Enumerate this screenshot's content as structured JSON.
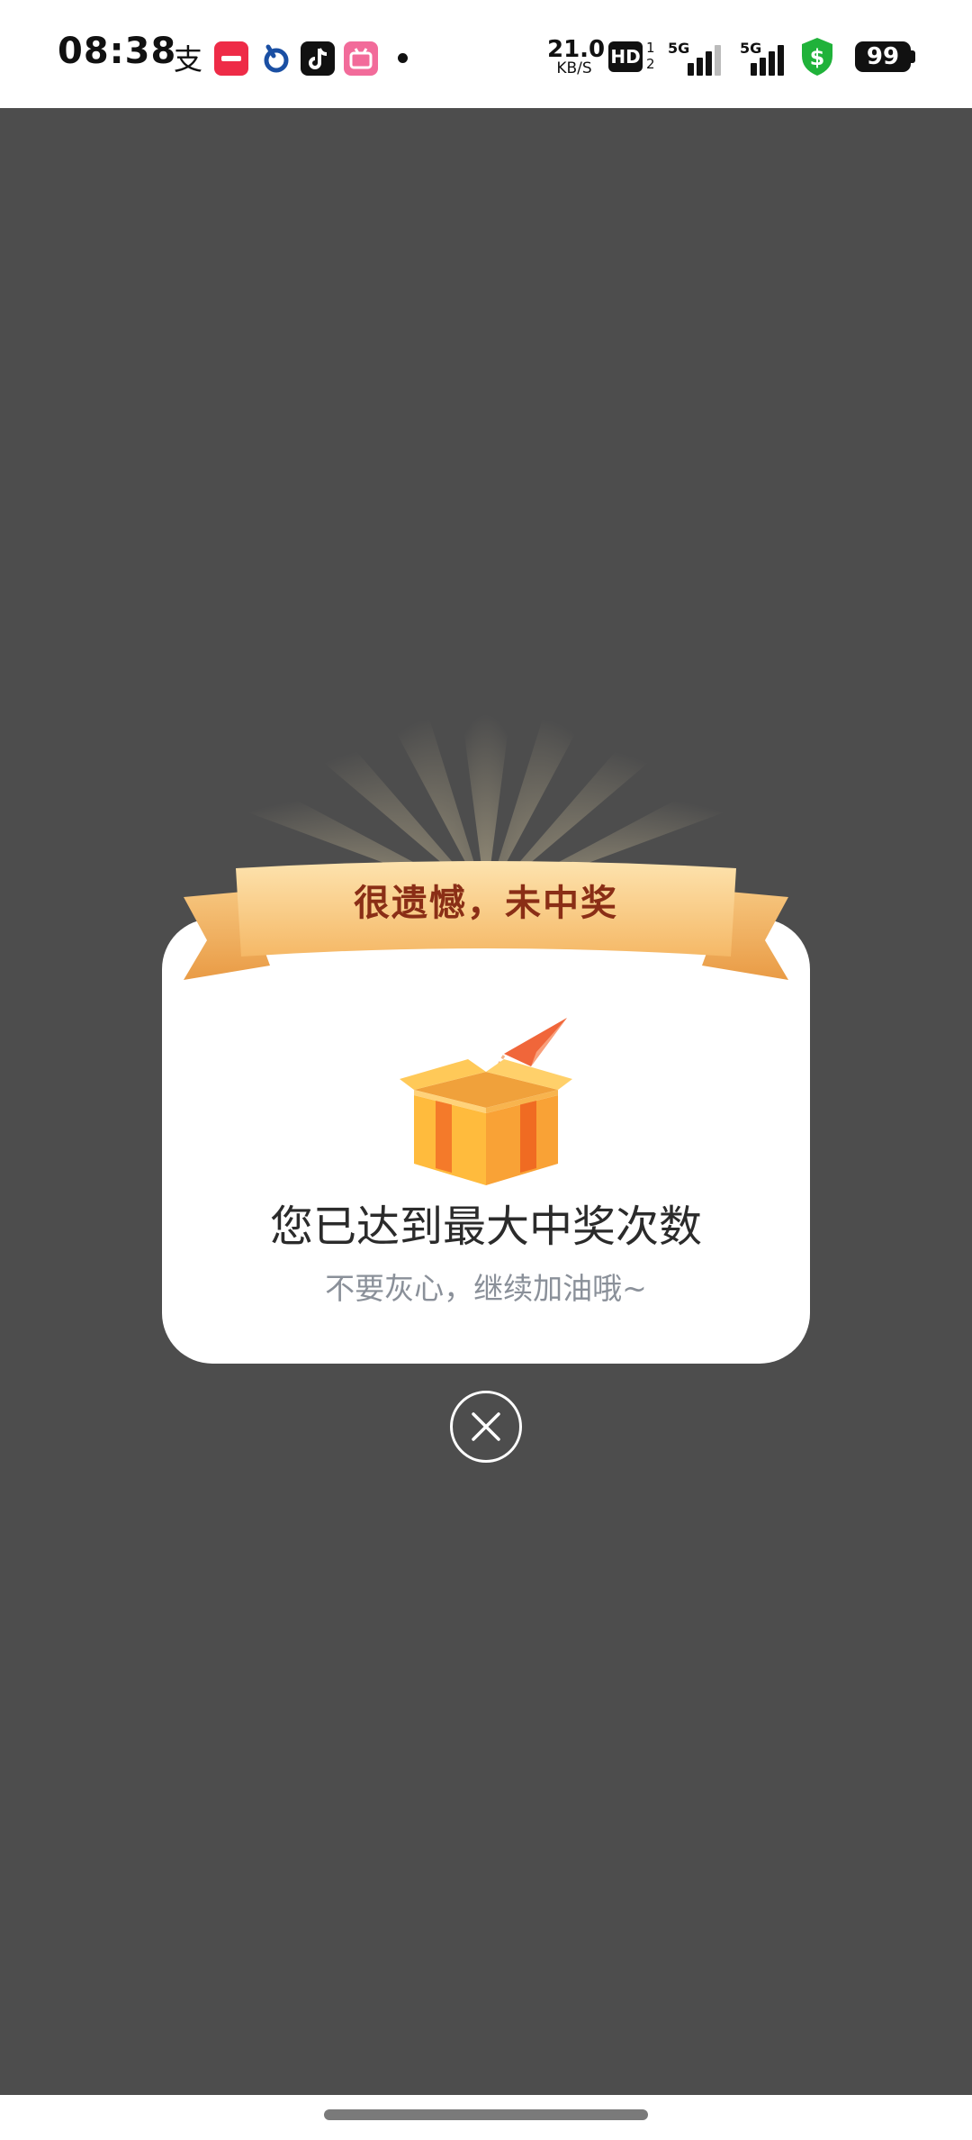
{
  "status_bar": {
    "time": "08:38",
    "net_speed_value": "21.0",
    "net_speed_unit": "KB/S",
    "hd_label": "HD",
    "hd_sub": "1\n2",
    "signal1_label": "5G",
    "signal2_label": "5G",
    "battery": "99",
    "app_icons": [
      "alipay-icon",
      "xiaohongshu-icon",
      "app-icon",
      "tiktok-icon",
      "bilibili-icon"
    ]
  },
  "dialog": {
    "banner_title": "很遗憾，未中奖",
    "title": "您已达到最大中奖次数",
    "subtitle": "不要灰心，继续加油哦~",
    "close_icon": "close-circle-icon"
  },
  "colors": {
    "overlay": "#4d4d4d",
    "banner_text": "#8a2e16",
    "banner_gold": "#f7c77a",
    "card_bg": "#ffffff",
    "box_orange": "#f6a13a"
  }
}
